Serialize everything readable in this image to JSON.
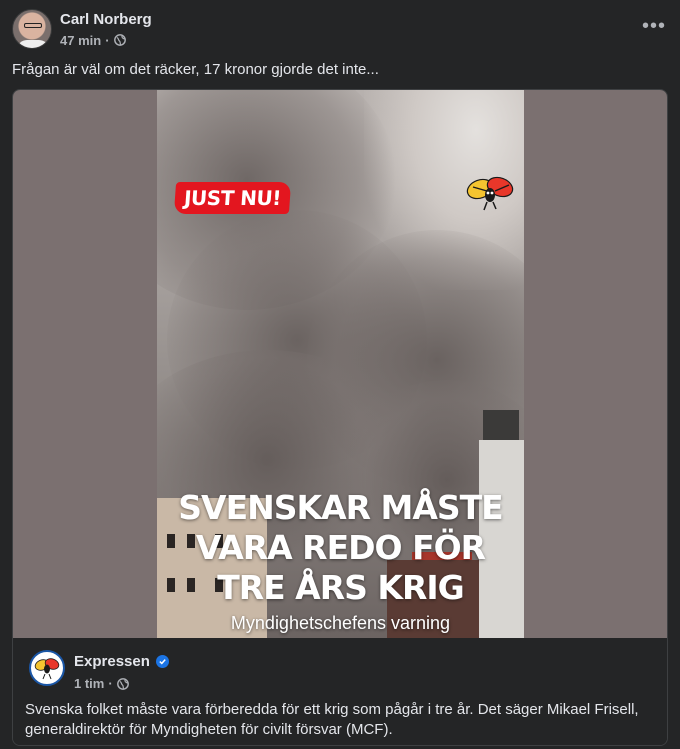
{
  "post": {
    "author": "Carl Norberg",
    "time": "47 min",
    "separator": "·",
    "text": "Frågan är väl om det räcker, 17 kronor gjorde det inte...",
    "more_label": "•••",
    "audience_icon": "globe-icon"
  },
  "shared": {
    "badge": "JUST NU!",
    "headline_lines": [
      "SVENSKAR MÅSTE",
      "VARA REDO FÖR",
      "TRE ÅRS KRIG"
    ],
    "caption": "Myndighetschefens varning",
    "page_name": "Expressen",
    "page_time": "1 tim",
    "separator": "·",
    "text": "Svenska folket måste vara förberedda för ett krig som pågår i tre år. Det säger Mikael Frisell, generaldirektör för Myndigheten för civilt försvar (MCF).",
    "verified_icon": "verified-badge-icon"
  },
  "colors": {
    "background": "#242526",
    "text_primary": "#e4e6eb",
    "text_secondary": "#b0b3b8",
    "badge_red": "#e3161f",
    "verified_blue": "#1b74e4"
  }
}
